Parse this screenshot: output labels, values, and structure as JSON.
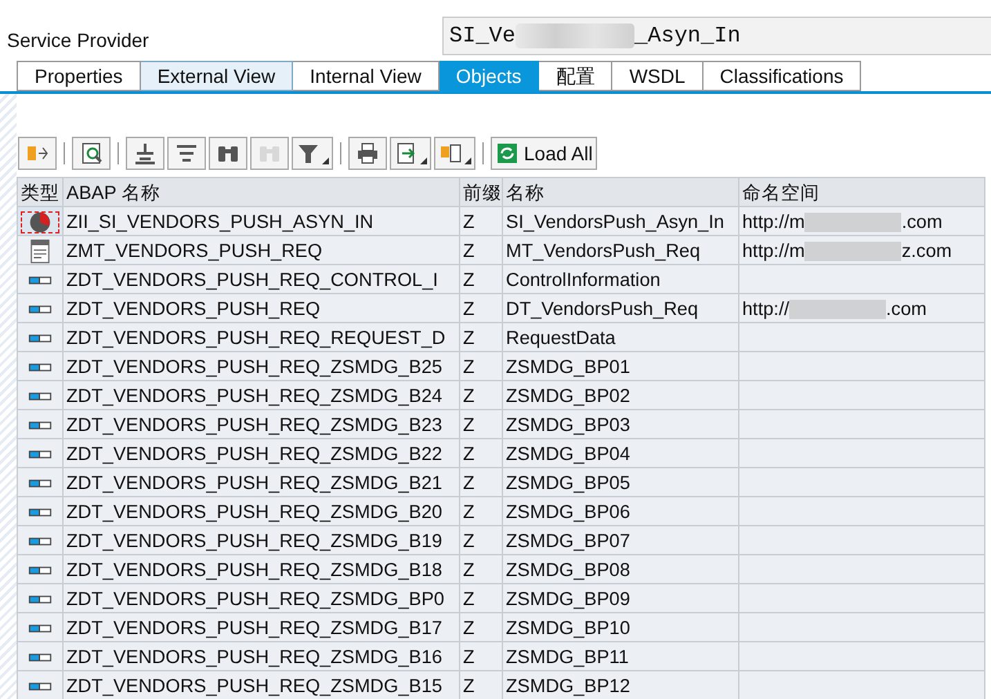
{
  "header": {
    "label": "Service Provider",
    "field_parts": [
      "SI_Ve",
      "_Asyn_In"
    ]
  },
  "tabs": [
    {
      "label": "Properties",
      "selected": false,
      "focused": false
    },
    {
      "label": "External View",
      "selected": false,
      "focused": true
    },
    {
      "label": "Internal View",
      "selected": false,
      "focused": false
    },
    {
      "label": "Objects",
      "selected": true,
      "focused": false
    },
    {
      "label": "配置",
      "selected": false,
      "focused": false
    },
    {
      "label": "WSDL",
      "selected": false,
      "focused": false
    },
    {
      "label": "Classifications",
      "selected": false,
      "focused": false
    }
  ],
  "toolbar": [
    {
      "kind": "expand",
      "dropdown": false,
      "disabled": false
    },
    {
      "kind": "separator"
    },
    {
      "kind": "detail",
      "dropdown": false,
      "disabled": false
    },
    {
      "kind": "separator"
    },
    {
      "kind": "collapse",
      "dropdown": false,
      "disabled": false
    },
    {
      "kind": "lines",
      "dropdown": false,
      "disabled": false
    },
    {
      "kind": "find",
      "dropdown": false,
      "disabled": false
    },
    {
      "kind": "find",
      "dropdown": false,
      "disabled": true
    },
    {
      "kind": "filter",
      "dropdown": true,
      "disabled": false
    },
    {
      "kind": "separator"
    },
    {
      "kind": "print",
      "dropdown": false,
      "disabled": false
    },
    {
      "kind": "export",
      "dropdown": true,
      "disabled": false
    },
    {
      "kind": "layout",
      "dropdown": true,
      "disabled": false
    },
    {
      "kind": "separator"
    },
    {
      "kind": "load",
      "label": "Load All",
      "dropdown": false,
      "disabled": false
    }
  ],
  "table": {
    "columns": [
      "类型",
      "ABAP 名称",
      "前缀",
      "名称",
      "命名空间"
    ],
    "rows": [
      {
        "kind": "interface",
        "selected": true,
        "abap_name": "ZII_SI_VENDORS_PUSH_ASYN_IN",
        "prefix": "Z",
        "name": "SI_VendorsPush_Asyn_In",
        "namespace_parts": [
          "http://m",
          ".com"
        ]
      },
      {
        "kind": "message",
        "selected": false,
        "abap_name": "ZMT_VENDORS_PUSH_REQ",
        "prefix": "Z",
        "name": "MT_VendorsPush_Req",
        "namespace_parts": [
          "http://m",
          "z.com"
        ]
      },
      {
        "kind": "datatype",
        "selected": false,
        "abap_name": "ZDT_VENDORS_PUSH_REQ_CONTROL_I",
        "prefix": "Z",
        "name": "ControlInformation"
      },
      {
        "kind": "datatype",
        "selected": false,
        "abap_name": "ZDT_VENDORS_PUSH_REQ",
        "prefix": "Z",
        "name": "DT_VendorsPush_Req",
        "namespace_parts": [
          "http://",
          ".com"
        ]
      },
      {
        "kind": "datatype",
        "selected": false,
        "abap_name": "ZDT_VENDORS_PUSH_REQ_REQUEST_D",
        "prefix": "Z",
        "name": "RequestData"
      },
      {
        "kind": "datatype",
        "selected": false,
        "abap_name": "ZDT_VENDORS_PUSH_REQ_ZSMDG_B25",
        "prefix": "Z",
        "name": "ZSMDG_BP01"
      },
      {
        "kind": "datatype",
        "selected": false,
        "abap_name": "ZDT_VENDORS_PUSH_REQ_ZSMDG_B24",
        "prefix": "Z",
        "name": "ZSMDG_BP02"
      },
      {
        "kind": "datatype",
        "selected": false,
        "abap_name": "ZDT_VENDORS_PUSH_REQ_ZSMDG_B23",
        "prefix": "Z",
        "name": "ZSMDG_BP03"
      },
      {
        "kind": "datatype",
        "selected": false,
        "abap_name": "ZDT_VENDORS_PUSH_REQ_ZSMDG_B22",
        "prefix": "Z",
        "name": "ZSMDG_BP04"
      },
      {
        "kind": "datatype",
        "selected": false,
        "abap_name": "ZDT_VENDORS_PUSH_REQ_ZSMDG_B21",
        "prefix": "Z",
        "name": "ZSMDG_BP05"
      },
      {
        "kind": "datatype",
        "selected": false,
        "abap_name": "ZDT_VENDORS_PUSH_REQ_ZSMDG_B20",
        "prefix": "Z",
        "name": "ZSMDG_BP06"
      },
      {
        "kind": "datatype",
        "selected": false,
        "abap_name": "ZDT_VENDORS_PUSH_REQ_ZSMDG_B19",
        "prefix": "Z",
        "name": "ZSMDG_BP07"
      },
      {
        "kind": "datatype",
        "selected": false,
        "abap_name": "ZDT_VENDORS_PUSH_REQ_ZSMDG_B18",
        "prefix": "Z",
        "name": "ZSMDG_BP08"
      },
      {
        "kind": "datatype",
        "selected": false,
        "abap_name": "ZDT_VENDORS_PUSH_REQ_ZSMDG_BP0",
        "prefix": "Z",
        "name": "ZSMDG_BP09"
      },
      {
        "kind": "datatype",
        "selected": false,
        "abap_name": "ZDT_VENDORS_PUSH_REQ_ZSMDG_B17",
        "prefix": "Z",
        "name": "ZSMDG_BP10"
      },
      {
        "kind": "datatype",
        "selected": false,
        "abap_name": "ZDT_VENDORS_PUSH_REQ_ZSMDG_B16",
        "prefix": "Z",
        "name": "ZSMDG_BP11"
      },
      {
        "kind": "datatype",
        "selected": false,
        "abap_name": "ZDT_VENDORS_PUSH_REQ_ZSMDG_B15",
        "prefix": "Z",
        "name": "ZSMDG_BP12"
      }
    ]
  }
}
